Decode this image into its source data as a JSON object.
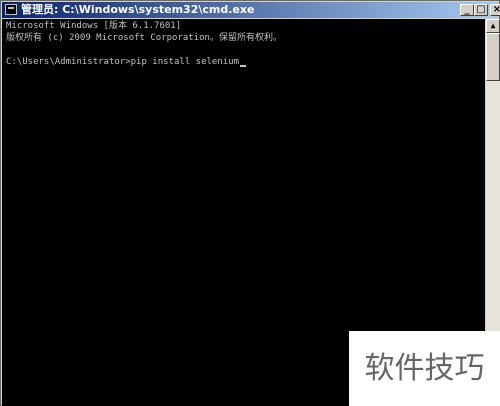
{
  "window": {
    "title": "管理员: C:\\Windows\\system32\\cmd.exe",
    "controls": {
      "minimize": "_",
      "maximize": "□",
      "close": "×"
    }
  },
  "console": {
    "lines": [
      "Microsoft Windows [版本 6.1.7601]",
      "版权所有 (c) 2009 Microsoft Corporation。保留所有权利。",
      "",
      "C:\\Users\\Administrator>pip install selenium"
    ]
  },
  "scrollbar": {
    "up_arrow": "▲"
  },
  "watermark": {
    "text": "软件技巧"
  },
  "colors": {
    "console_bg": "#000000",
    "console_text": "#c0c0c0",
    "title_start": "#0a246a",
    "title_end": "#a6caf0"
  }
}
